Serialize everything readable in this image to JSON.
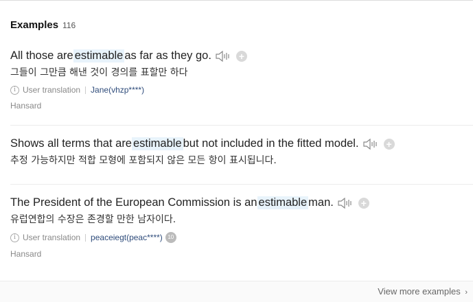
{
  "header": {
    "title": "Examples",
    "count": "116"
  },
  "examples": [
    {
      "sentence_before": "All those are ",
      "highlight": "estimable",
      "sentence_after": " as far as they go.",
      "translation": "그들이 그만큼 해낸 것이 경의를 표할만 하다",
      "user_translation_label": "User translation",
      "user": "Jane(vhzp****)",
      "source": "Hansard"
    },
    {
      "sentence_before": "Shows all terms that are ",
      "highlight": "estimable",
      "sentence_after": " but not included in the fitted model.",
      "translation": "추정 가능하지만 적합 모형에 포함되지 않은 모든 항이 표시됩니다."
    },
    {
      "sentence_before": "The President of the European Commission is an ",
      "highlight": "estimable",
      "sentence_after": " man.",
      "translation": "유럽연합의 수장은 존경할 만한 남자이다.",
      "user_translation_label": "User translation",
      "user": "peaceiegt(peac****)",
      "user_badge": "10",
      "source": "Hansard"
    }
  ],
  "footer": {
    "view_more": "View more examples"
  },
  "icons": {
    "speaker": "speaker-icon",
    "add": "plus-icon",
    "info": "info-icon",
    "chevron": "chevron-right-icon"
  },
  "colors": {
    "highlight": "#e8f3fb",
    "user_link": "#2e4b7a"
  }
}
